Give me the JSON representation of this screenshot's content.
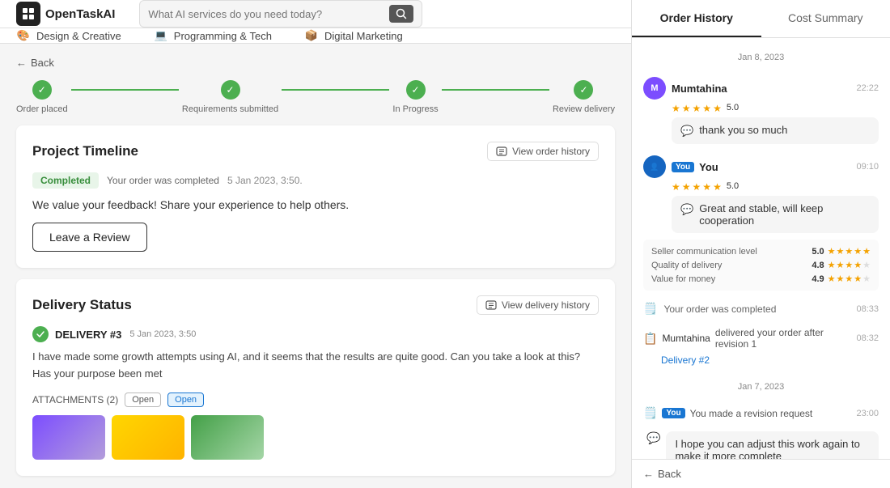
{
  "app": {
    "logo_text": "OpenTaskAI",
    "search_placeholder": "What AI services do you need today?"
  },
  "categories": [
    {
      "id": "design",
      "label": "Design & Creative",
      "icon": "🎨"
    },
    {
      "id": "programming",
      "label": "Programming & Tech",
      "icon": "💻"
    },
    {
      "id": "marketing",
      "label": "Digital Marketing",
      "icon": "📦"
    }
  ],
  "back_label": "Back",
  "progress_steps": [
    {
      "label": "Order placed",
      "done": true
    },
    {
      "label": "Requirements submitted",
      "done": true
    },
    {
      "label": "In Progress",
      "done": true
    },
    {
      "label": "Review delivery",
      "done": true
    }
  ],
  "project_timeline": {
    "title": "Project Timeline",
    "view_history_label": "View order history",
    "completed_badge": "Completed",
    "status_text": "Your order was completed",
    "status_date": "5 Jan 2023, 3:50.",
    "feedback_text": "We value your feedback! Share your experience to help others.",
    "leave_review_label": "Leave a Review"
  },
  "delivery_status": {
    "title": "Delivery Status",
    "view_history_label": "View delivery history",
    "delivery_num": "DELIVERY #3",
    "delivery_date": "5 Jan 2023, 3:50",
    "delivery_body": "I have made some growth attempts using AI, and it seems that the results are quite good. Can you take a look at this? Has your purpose been met",
    "attachments_label": "ATTACHMENTS (2)",
    "open_label": "Open",
    "open_badge": "Open"
  },
  "right_panel": {
    "tab_order_history": "Order History",
    "tab_cost_summary": "Cost Summary",
    "active_tab": "order_history",
    "date1": "Jan 8, 2023",
    "date2": "Jan 7, 2023",
    "messages": [
      {
        "id": "mumtahina1",
        "sender": "Mumtahina",
        "time": "22:22",
        "rating": "5.0",
        "text": "thank you so much",
        "type": "seller"
      },
      {
        "id": "you1",
        "sender": "You",
        "time": "09:10",
        "rating": "5.0",
        "text": "Great and stable, will keep cooperation",
        "type": "buyer",
        "sub_ratings": [
          {
            "label": "Seller communication level",
            "value": "5.0",
            "stars": 5
          },
          {
            "label": "Quality of delivery",
            "value": "4.8",
            "stars": 5
          },
          {
            "label": "Value for money",
            "value": "4.9",
            "stars": 5
          }
        ]
      }
    ],
    "system_completed": "Your order was completed",
    "system_completed_time": "08:33",
    "mumtahina_delivery": "Mumtahina",
    "delivery_text": "delivered your order after revision 1",
    "delivery_time": "08:32",
    "delivery_tag": "Delivery #2",
    "you2_label": "You",
    "you2_time": "23:00",
    "you2_text": "You made a revision request",
    "hope_text": "I hope you can adjust this work again to make it more complete",
    "back_label": "Back"
  }
}
